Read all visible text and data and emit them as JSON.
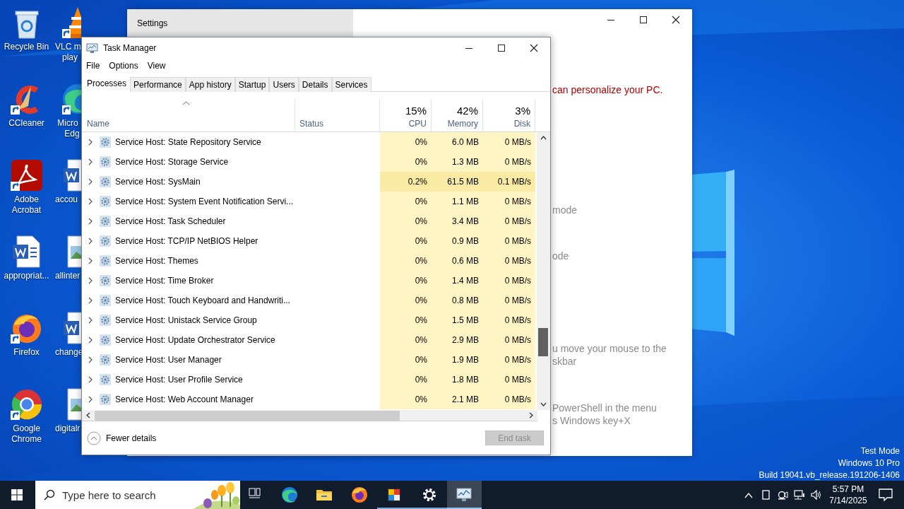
{
  "desktop": {
    "icons": [
      {
        "label": "Recycle Bin",
        "kind": "recycle-bin",
        "shortcut": false
      },
      {
        "label": "CCleaner",
        "kind": "ccleaner",
        "shortcut": true
      },
      {
        "label": "Adobe Acrobat",
        "kind": "acrobat",
        "shortcut": true
      },
      {
        "label": "appropriat...",
        "kind": "word-doc",
        "shortcut": false
      },
      {
        "label": "Firefox",
        "kind": "firefox",
        "shortcut": true
      },
      {
        "label": "Google Chrome",
        "kind": "chrome",
        "shortcut": true
      }
    ],
    "icons_column_2": [
      {
        "label": "VLC m\n   play",
        "kind": "vlc",
        "shortcut": true
      },
      {
        "label": " Micro\n    Edg",
        "kind": "edge",
        "shortcut": true
      },
      {
        "label": "accou",
        "kind": "word-doc",
        "shortcut": false
      },
      {
        "label": "allinter",
        "kind": "image-doc",
        "shortcut": false
      },
      {
        "label": "change",
        "kind": "word-doc",
        "shortcut": false
      },
      {
        "label": "digitalr",
        "kind": "image-doc",
        "shortcut": false
      }
    ]
  },
  "wallpaper_text": [
    "Test Mode",
    "Windows 10 Pro",
    "Build 19041.vb_release.191206-1406"
  ],
  "settings_window": {
    "title": "Settings",
    "lines": [
      {
        "text": "can personalize your PC.",
        "kind": "warning"
      },
      {
        "text": "mode",
        "kind": "note"
      },
      {
        "text": "ode",
        "kind": "note"
      },
      {
        "text": "u move your mouse to the",
        "kind": "note"
      },
      {
        "text": "skbar",
        "kind": "note"
      },
      {
        "text": "PowerShell in the menu",
        "kind": "note"
      },
      {
        "text": "s Windows key+X",
        "kind": "note"
      }
    ]
  },
  "task_manager": {
    "title": "Task Manager",
    "menu": [
      "File",
      "Options",
      "View"
    ],
    "tabs": [
      {
        "label": "Processes",
        "selected": true
      },
      {
        "label": "Performance",
        "selected": false
      },
      {
        "label": "App history",
        "selected": false
      },
      {
        "label": "Startup",
        "selected": false
      },
      {
        "label": "Users",
        "selected": false
      },
      {
        "label": "Details",
        "selected": false
      },
      {
        "label": "Services",
        "selected": false
      }
    ],
    "columns": [
      {
        "label": "Name"
      },
      {
        "label": "Status"
      },
      {
        "label": "CPU",
        "total": "15%"
      },
      {
        "label": "Memory",
        "total": "42%"
      },
      {
        "label": "Disk",
        "total": "3%"
      }
    ],
    "rows": [
      {
        "name": "Service Host: State Repository Service",
        "cpu": "0%",
        "memory": "6.0 MB",
        "disk": "0 MB/s",
        "busy": false
      },
      {
        "name": "Service Host: Storage Service",
        "cpu": "0%",
        "memory": "1.3 MB",
        "disk": "0 MB/s",
        "busy": false
      },
      {
        "name": "Service Host: SysMain",
        "cpu": "0.2%",
        "memory": "61.5 MB",
        "disk": "0.1 MB/s",
        "busy": true
      },
      {
        "name": "Service Host: System Event Notification Servi...",
        "cpu": "0%",
        "memory": "1.1 MB",
        "disk": "0 MB/s",
        "busy": false
      },
      {
        "name": "Service Host: Task Scheduler",
        "cpu": "0%",
        "memory": "3.4 MB",
        "disk": "0 MB/s",
        "busy": false
      },
      {
        "name": "Service Host: TCP/IP NetBIOS Helper",
        "cpu": "0%",
        "memory": "0.9 MB",
        "disk": "0 MB/s",
        "busy": false
      },
      {
        "name": "Service Host: Themes",
        "cpu": "0%",
        "memory": "0.6 MB",
        "disk": "0 MB/s",
        "busy": false
      },
      {
        "name": "Service Host: Time Broker",
        "cpu": "0%",
        "memory": "1.4 MB",
        "disk": "0 MB/s",
        "busy": false
      },
      {
        "name": "Service Host: Touch Keyboard and Handwriti...",
        "cpu": "0%",
        "memory": "0.8 MB",
        "disk": "0 MB/s",
        "busy": false
      },
      {
        "name": "Service Host: Unistack Service Group",
        "cpu": "0%",
        "memory": "1.5 MB",
        "disk": "0 MB/s",
        "busy": false
      },
      {
        "name": "Service Host: Update Orchestrator Service",
        "cpu": "0%",
        "memory": "2.9 MB",
        "disk": "0 MB/s",
        "busy": false
      },
      {
        "name": "Service Host: User Manager",
        "cpu": "0%",
        "memory": "1.9 MB",
        "disk": "0 MB/s",
        "busy": false
      },
      {
        "name": "Service Host: User Profile Service",
        "cpu": "0%",
        "memory": "1.8 MB",
        "disk": "0 MB/s",
        "busy": false
      },
      {
        "name": "Service Host: Web Account Manager",
        "cpu": "0%",
        "memory": "2.1 MB",
        "disk": "0 MB/s",
        "busy": false
      }
    ],
    "fewer_details": "Fewer details",
    "end_task": {
      "label": "End task",
      "disabled": true
    }
  },
  "taskbar": {
    "search": {
      "placeholder": "Type here to search"
    },
    "apps": [
      {
        "kind": "task-view",
        "running": false,
        "selected": false
      },
      {
        "kind": "edge",
        "running": false,
        "selected": false
      },
      {
        "kind": "explorer",
        "running": false,
        "selected": false
      },
      {
        "kind": "firefox",
        "running": false,
        "selected": false
      },
      {
        "kind": "paint",
        "running": true,
        "selected": false
      },
      {
        "kind": "settings",
        "running": true,
        "selected": false
      },
      {
        "kind": "task-manager",
        "running": true,
        "selected": true
      }
    ],
    "clock": {
      "time": "5:57 PM",
      "date": "7/14/2025"
    }
  }
}
